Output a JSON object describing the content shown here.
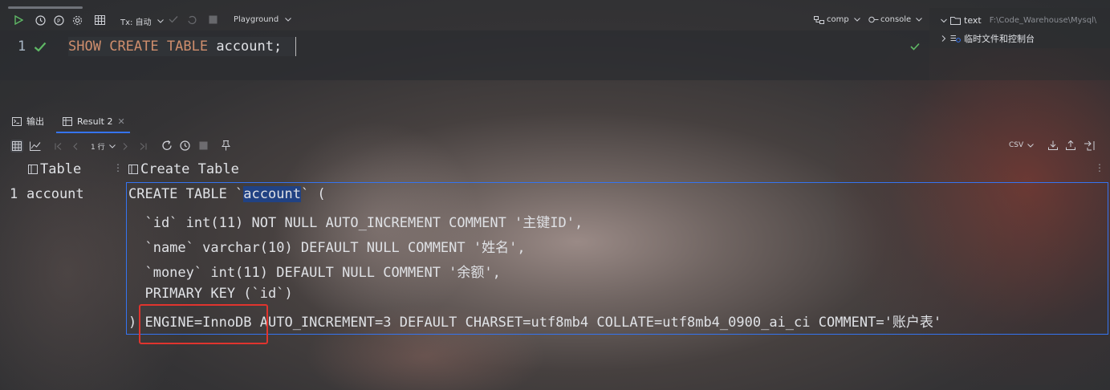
{
  "toolbar": {
    "tx_label": "Tx: 自动",
    "playground_label": "Playground",
    "schema_label": "comp",
    "console_label": "console"
  },
  "editor": {
    "line_number": "1",
    "kw_show": "SHOW",
    "kw_create": "CREATE",
    "kw_table": "TABLE",
    "table_name": "account",
    "terminator": ";"
  },
  "project_tree": {
    "folder_name": "text",
    "folder_path": "F:\\Code_Warehouse\\Mysql\\",
    "scratches": "临时文件和控制台"
  },
  "results": {
    "tabs": [
      {
        "label": "输出"
      },
      {
        "label": "Result 2"
      }
    ],
    "rows_label": "1 行",
    "export_format": "CSV",
    "columns": [
      "Table",
      "Create Table"
    ],
    "row_number": "1",
    "row_table": "account",
    "ddl": {
      "line1_prefix": "CREATE TABLE `",
      "line1_name": "account",
      "line1_suffix": "` (",
      "line2": "  `id` int(11) NOT NULL AUTO_INCREMENT COMMENT '主键ID',",
      "line3": "  `name` varchar(10) DEFAULT NULL COMMENT '姓名',",
      "line4": "  `money` int(11) DEFAULT NULL COMMENT '余额',",
      "line5": "  PRIMARY KEY (`id`)",
      "line6": ") ENGINE=InnoDB AUTO_INCREMENT=3 DEFAULT CHARSET=utf8mb4 COLLATE=utf8mb4_0900_ai_ci COMMENT='账户表'"
    }
  },
  "colors": {
    "accent": "#3574f0",
    "keyword": "#cf8e6d",
    "success": "#5fb865",
    "highlight_box": "#e0342e"
  }
}
